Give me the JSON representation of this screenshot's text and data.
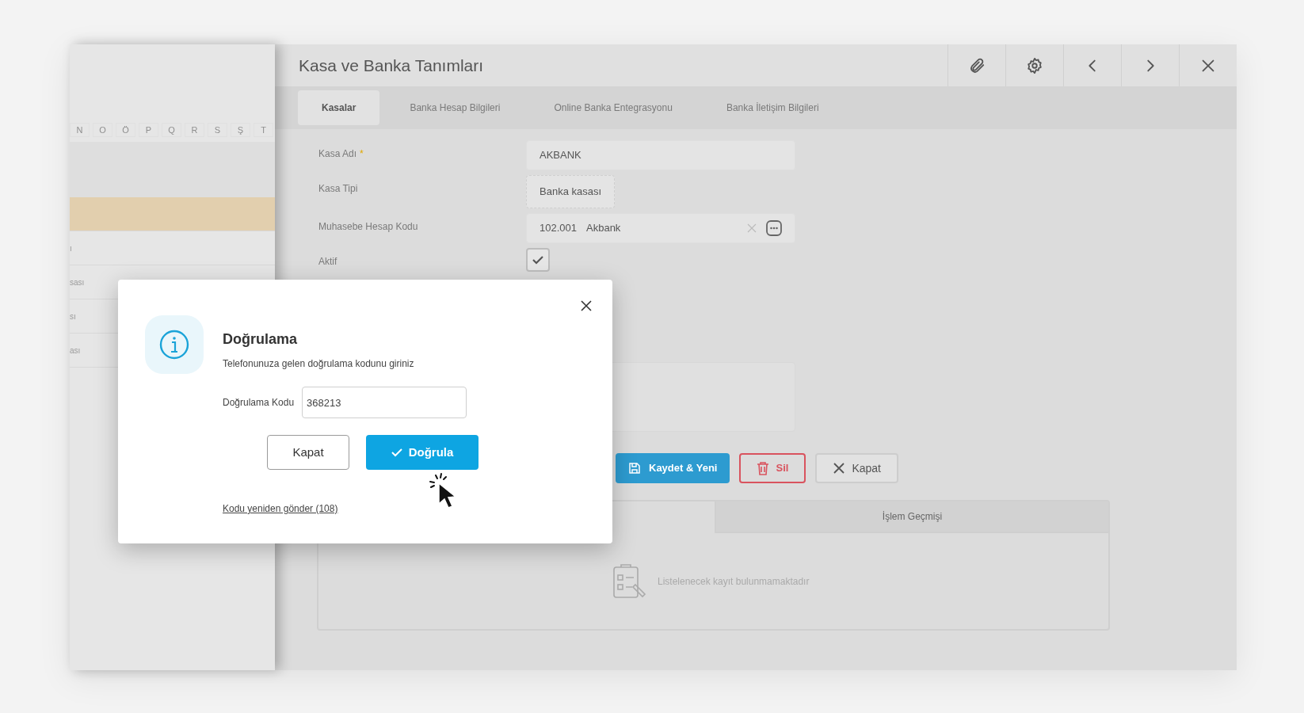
{
  "background_sheet": {
    "column_letters": [
      "N",
      "O",
      "Ö",
      "P",
      "Q",
      "R",
      "S",
      "Ş",
      "T"
    ],
    "rows": [
      {
        "selected": true
      },
      {
        "text": "ı",
        "selected": false
      },
      {
        "text": "sası",
        "selected": false
      },
      {
        "text": "sı",
        "selected": false
      },
      {
        "text": "ası",
        "selected": false
      }
    ]
  },
  "window": {
    "title": "Kasa ve Banka Tanımları",
    "tabs": [
      {
        "label": "Kasalar",
        "selected": true
      },
      {
        "label": "Banka Hesap Bilgileri",
        "selected": false
      },
      {
        "label": "Online Banka Entegrasyonu",
        "selected": false
      },
      {
        "label": "Banka İletişim Bilgileri",
        "selected": false
      }
    ],
    "form": [
      {
        "kind": "text",
        "label": "Kasa Adı",
        "required_mark": "*",
        "value": "AKBANK"
      },
      {
        "kind": "chip",
        "label": "Kasa Tipi",
        "value": "Banka kasası"
      },
      {
        "kind": "lookup",
        "label": "Muhasebe Hesap Kodu",
        "code": "102.001",
        "value": "Akbank"
      },
      {
        "kind": "checkbox",
        "label": "Aktif",
        "checked": true
      }
    ],
    "actions": [
      {
        "kind": "primary",
        "label": "Kaydet & Yeni"
      },
      {
        "kind": "danger",
        "label": "Sil"
      },
      {
        "kind": "default",
        "label": "Kapat"
      }
    ],
    "history_tabs": [
      {
        "label": "İşlem Geçmişi",
        "selected": false
      }
    ],
    "empty_message": "Listelenecek kayıt bulunmamaktadır"
  },
  "dialog": {
    "title": "Doğrulama",
    "message": "Telefonunuza gelen doğrulama kodunu giriniz",
    "field": {
      "label": "Doğrulama Kodu",
      "value": "368213"
    },
    "buttons": [
      {
        "kind": "default",
        "label": "Kapat"
      },
      {
        "kind": "primary",
        "label": "Doğrula"
      }
    ],
    "resend_link": "Kodu yeniden gönder (108)"
  }
}
